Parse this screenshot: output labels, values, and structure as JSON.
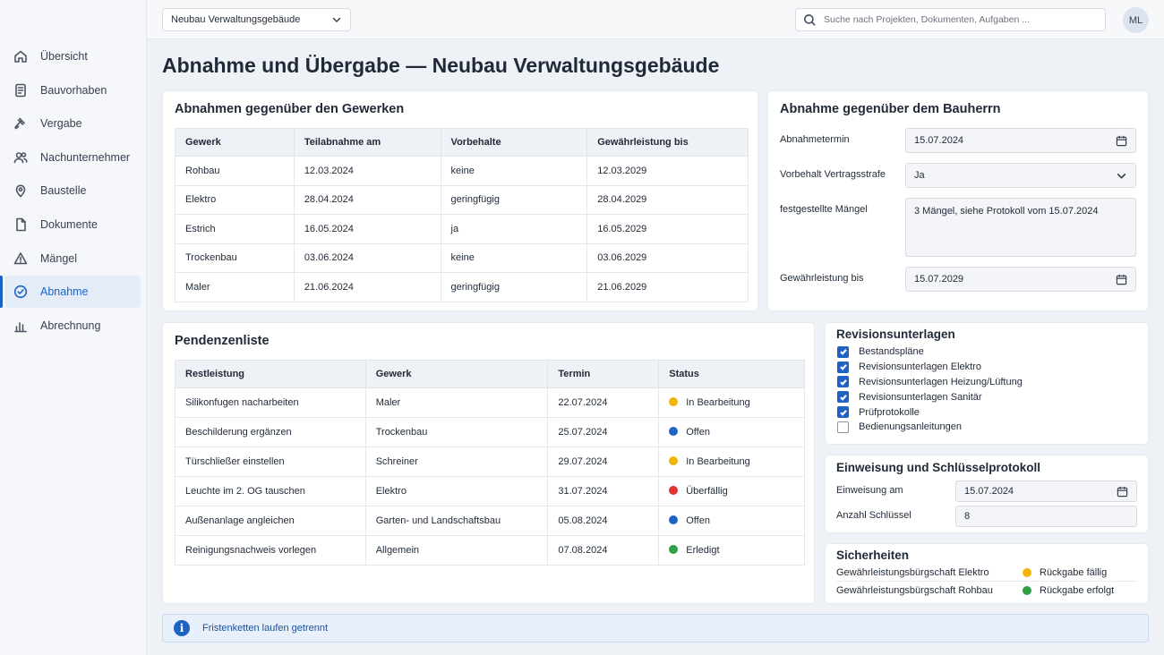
{
  "topbar": {
    "project_select": "Neubau Verwaltungsgebäude",
    "search_placeholder": "Suche nach Projekten, Dokumenten, Aufgaben ...",
    "avatar_initials": "ML"
  },
  "sidebar": {
    "items": [
      {
        "label": "Übersicht",
        "icon": "home-icon"
      },
      {
        "label": "Bauvorhaben",
        "icon": "document-icon"
      },
      {
        "label": "Vergabe",
        "icon": "gavel-icon"
      },
      {
        "label": "Nachunternehmer",
        "icon": "users-icon"
      },
      {
        "label": "Baustelle",
        "icon": "map-pin-icon"
      },
      {
        "label": "Dokumente",
        "icon": "file-icon"
      },
      {
        "label": "Mängel",
        "icon": "warning-icon"
      },
      {
        "label": "Abnahme",
        "icon": "check-circle-icon",
        "active": true
      },
      {
        "label": "Abrechnung",
        "icon": "bar-chart-icon"
      }
    ]
  },
  "page": {
    "title": "Abnahme und Übergabe — Neubau Verwaltungsgebäude"
  },
  "gewerke": {
    "title": "Abnahmen gegenüber den Gewerken",
    "headers": [
      "Gewerk",
      "Teilabnahme am",
      "Vorbehalte",
      "Gewährleistung bis"
    ],
    "rows": [
      [
        "Rohbau",
        "12.03.2024",
        "keine",
        "12.03.2029"
      ],
      [
        "Elektro",
        "28.04.2024",
        "geringfügig",
        "28.04.2029"
      ],
      [
        "Estrich",
        "16.05.2024",
        "ja",
        "16.05.2029"
      ],
      [
        "Trockenbau",
        "03.06.2024",
        "keine",
        "03.06.2029"
      ],
      [
        "Maler",
        "21.06.2024",
        "geringfügig",
        "21.06.2029"
      ]
    ]
  },
  "bauherr": {
    "title": "Abnahme gegenüber dem Bauherrn",
    "abnahmetermin_label": "Abnahmetermin",
    "abnahmetermin_value": "15.07.2024",
    "vertragsstrafe_label": "Vorbehalt Vertragsstrafe",
    "vertragsstrafe_value": "Ja",
    "maengel_label": "festgestellte Mängel",
    "maengel_value": "3 Mängel, siehe Protokoll vom 15.07.2024",
    "gewaehrleistung_label": "Gewährleistung bis",
    "gewaehrleistung_value": "15.07.2029"
  },
  "pendenzen": {
    "title": "Pendenzenliste",
    "headers": [
      "Restleistung",
      "Gewerk",
      "Termin",
      "Status"
    ],
    "rows": [
      {
        "task": "Silikonfugen nacharbeiten",
        "trade": "Maler",
        "date": "22.07.2024",
        "status": "In Bearbeitung",
        "color": "#f2b705"
      },
      {
        "task": "Beschilderung ergänzen",
        "trade": "Trockenbau",
        "date": "25.07.2024",
        "status": "Offen",
        "color": "#1e63c4"
      },
      {
        "task": "Türschließer einstellen",
        "trade": "Schreiner",
        "date": "29.07.2024",
        "status": "In Bearbeitung",
        "color": "#f2b705"
      },
      {
        "task": "Leuchte im 2. OG tauschen",
        "trade": "Elektro",
        "date": "31.07.2024",
        "status": "Überfällig",
        "color": "#e03131"
      },
      {
        "task": "Außenanlage angleichen",
        "trade": "Garten- und Landschaftsbau",
        "date": "05.08.2024",
        "status": "Offen",
        "color": "#1e63c4"
      },
      {
        "task": "Reinigungsnachweis vorlegen",
        "trade": "Allgemein",
        "date": "07.08.2024",
        "status": "Erledigt",
        "color": "#2f9e44"
      }
    ]
  },
  "revision": {
    "title": "Revisionsunterlagen",
    "items": [
      {
        "label": "Bestandspläne",
        "checked": true
      },
      {
        "label": "Revisionsunterlagen Elektro",
        "checked": true
      },
      {
        "label": "Revisionsunterlagen Heizung/Lüftung",
        "checked": true
      },
      {
        "label": "Revisionsunterlagen Sanitär",
        "checked": true
      },
      {
        "label": "Prüfprotokolle",
        "checked": true
      },
      {
        "label": "Bedienungsanleitungen",
        "checked": false
      }
    ]
  },
  "einweisung": {
    "title": "Einweisung und Schlüsselprotokoll",
    "date_label": "Einweisung am",
    "date_value": "15.07.2024",
    "keys_label": "Anzahl Schlüssel",
    "keys_value": "8"
  },
  "sicherheiten": {
    "title": "Sicherheiten",
    "rows": [
      {
        "label": "Gewährleistungsbürgschaft Elektro",
        "status": "Rückgabe fällig",
        "color": "#f2b705"
      },
      {
        "label": "Gewährleistungsbürgschaft Rohbau",
        "status": "Rückgabe erfolgt",
        "color": "#2f9e44"
      }
    ]
  },
  "info": {
    "text": "Fristenketten laufen getrennt"
  },
  "colors": {
    "accent": "#1e63c4",
    "background": "#eef1f5"
  }
}
